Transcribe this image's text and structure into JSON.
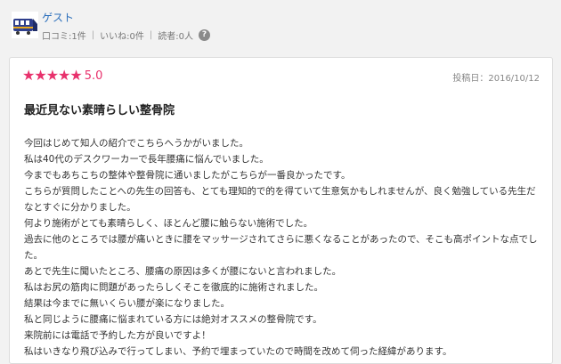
{
  "user": {
    "name": "ゲスト",
    "stats": [
      "口コミ:1件",
      "いいね:0件",
      "読者:0人"
    ],
    "help": "?"
  },
  "review": {
    "stars": [
      "★",
      "★",
      "★",
      "★",
      "★"
    ],
    "score": "5.0",
    "post_date": "投稿日：2016/10/12",
    "title": "最近見ない素晴らしい整骨院",
    "paragraphs": [
      "今回はじめて知人の紹介でこちらへうかがいました。",
      "私は40代のデスクワーカーで長年腰痛に悩んでいました。",
      "今までもあちこちの整体や整骨院に通いましたがこちらが一番良かったです。",
      "こちらが質問したことへの先生の回答も、とても理知的で的を得ていて生意気かもしれませんが、良く勉強している先生だなとすぐに分かりました。",
      "何より施術がとても素晴らしく、ほとんど腰に触らない施術でした。",
      "過去に他のところでは腰が痛いときに腰をマッサージされてさらに悪くなることがあったので、そこも高ポイントな点でした。",
      "あとで先生に聞いたところ、腰痛の原因は多くが腰にないと言われました。",
      "私はお尻の筋肉に問題があったらしくそこを徹底的に施術されました。",
      "結果は今までに無いくらい腰が楽になりました。",
      "私と同じように腰痛に悩まれている方には絶対オススメの整骨院です。",
      "来院前には電話で予約した方が良いですよ！",
      "私はいきなり飛び込みで行ってしまい、予約で埋まっていたので時間を改めて伺った経緯があります。"
    ]
  },
  "colors": {
    "accent": "#e8316c",
    "link": "#2a6ebb"
  },
  "icons": {
    "avatar": "train-avatar-icon",
    "help": "question-mark-icon",
    "star": "star-icon"
  }
}
